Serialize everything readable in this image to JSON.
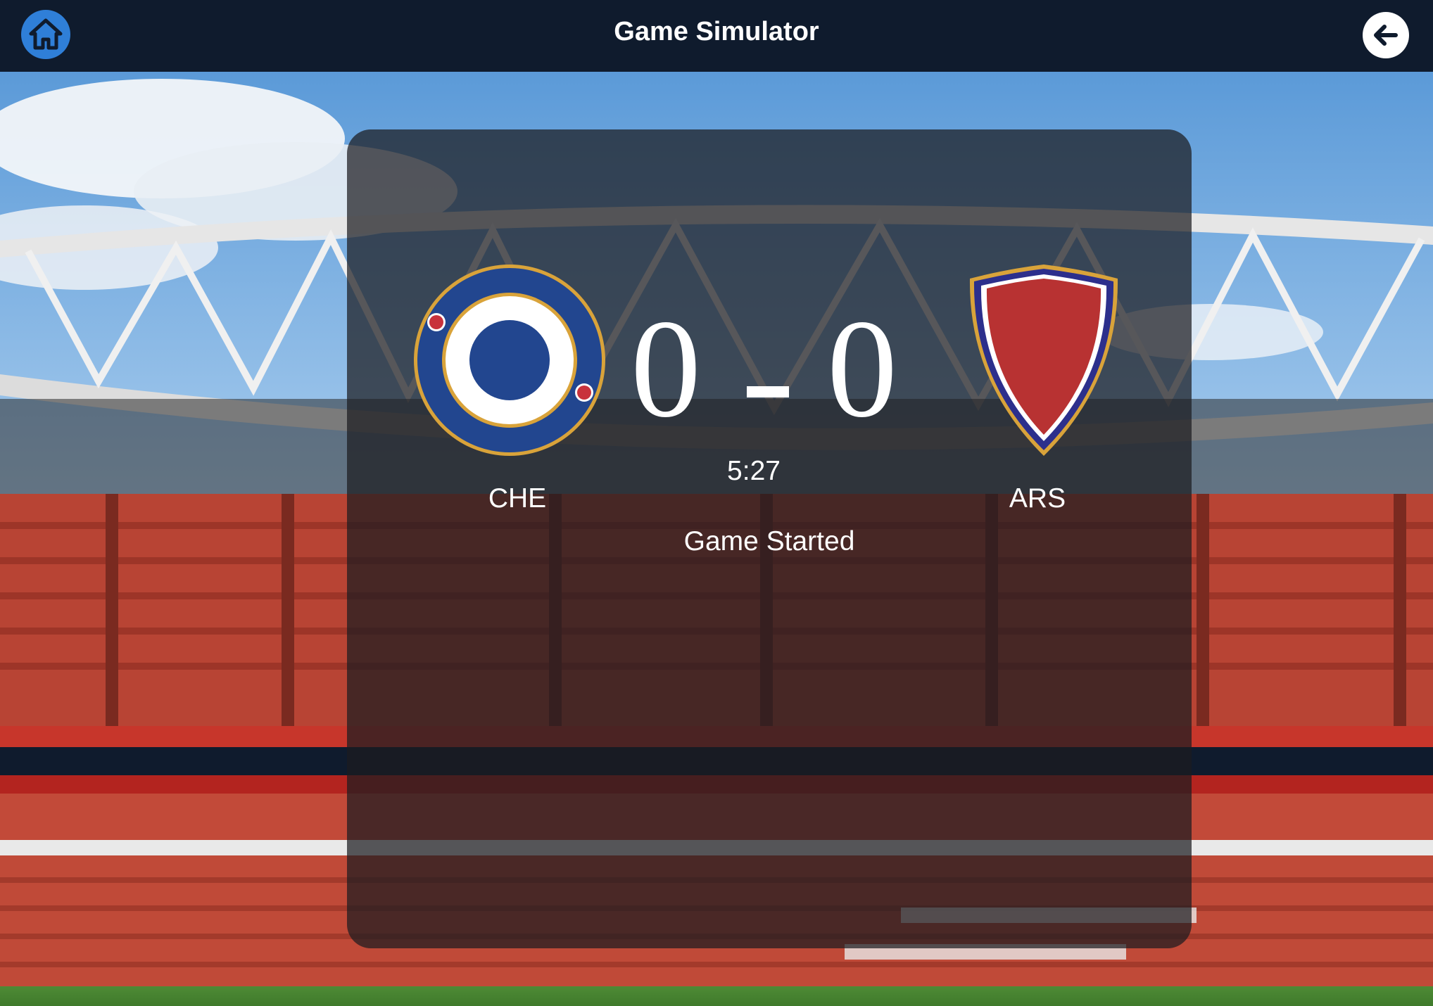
{
  "header": {
    "title": "Game Simulator",
    "home_icon": "home-icon",
    "back_icon": "arrow-left-icon"
  },
  "match": {
    "home": {
      "abbr": "CHE",
      "score": "0",
      "crest_icon": "che-crest-icon",
      "crest_colors": [
        "#22468f",
        "#d9a33a",
        "#ffffff",
        "#c8323c"
      ]
    },
    "away": {
      "abbr": "ARS",
      "score": "0",
      "crest_icon": "ars-crest-icon",
      "crest_colors": [
        "#b83232",
        "#2c2f8c",
        "#ffffff",
        "#d9a33a"
      ]
    },
    "separator": "-",
    "clock": "5:27",
    "status": "Game Started"
  },
  "colors": {
    "header_bg": "#0f1b2d",
    "home_button": "#2f7fd8",
    "panel": "rgba(28,28,32,0.72)"
  }
}
